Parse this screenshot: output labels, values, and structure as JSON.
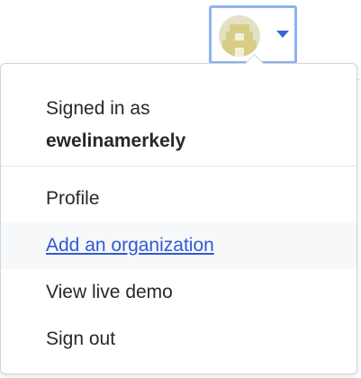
{
  "header": {
    "avatar_alt": "ewelinamerkely avatar"
  },
  "menu": {
    "signed_in_label": "Signed in as",
    "username": "ewelinamerkely",
    "items": [
      {
        "label": "Profile"
      },
      {
        "label": "Add an organization"
      },
      {
        "label": "View live demo"
      },
      {
        "label": "Sign out"
      }
    ]
  },
  "colors": {
    "focus_ring": "#8fb2f2",
    "caret": "#3b63d6",
    "link": "#2f5bd1",
    "hover_bg": "#f6f8fa"
  }
}
